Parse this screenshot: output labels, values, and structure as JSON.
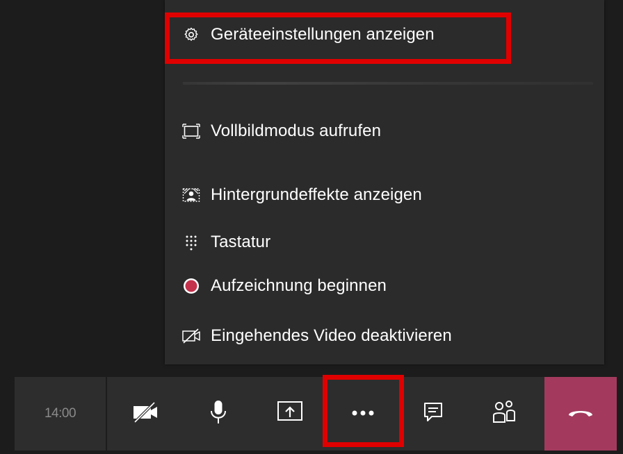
{
  "menu": {
    "items": [
      {
        "label": "Geräteeinstellungen anzeigen",
        "icon": "gear-icon"
      },
      {
        "label": "Vollbildmodus aufrufen",
        "icon": "fullscreen-icon"
      },
      {
        "label": "Hintergrundeffekte anzeigen",
        "icon": "background-effects-icon"
      },
      {
        "label": "Tastatur",
        "icon": "dialpad-icon"
      },
      {
        "label": "Aufzeichnung beginnen",
        "icon": "record-icon"
      },
      {
        "label": "Eingehendes Video deaktivieren",
        "icon": "video-off-icon"
      }
    ]
  },
  "toolbar": {
    "time": "14:00",
    "buttons": [
      {
        "name": "camera-off-button",
        "icon": "camera-off-icon"
      },
      {
        "name": "microphone-button",
        "icon": "microphone-icon"
      },
      {
        "name": "share-screen-button",
        "icon": "share-screen-icon"
      },
      {
        "name": "more-actions-button",
        "icon": "more-icon"
      },
      {
        "name": "chat-button",
        "icon": "chat-icon"
      },
      {
        "name": "participants-button",
        "icon": "participants-icon"
      },
      {
        "name": "hang-up-button",
        "icon": "hang-up-icon"
      }
    ]
  },
  "colors": {
    "background": "#1c1c1c",
    "menu_background": "#2b2b2b",
    "toolbar_background": "#2d2d2d",
    "highlight": "#e00000",
    "hangup": "#a33a5e",
    "record": "#c4314b"
  }
}
